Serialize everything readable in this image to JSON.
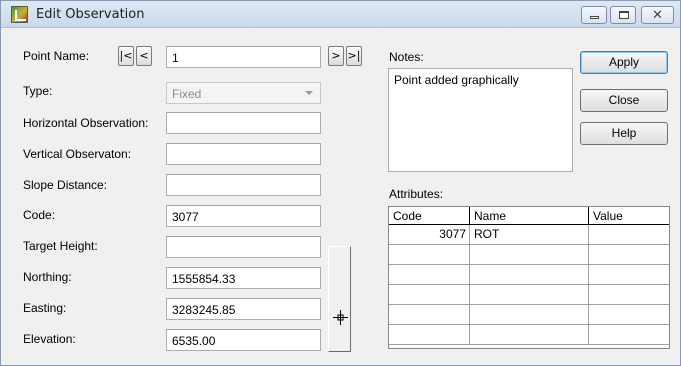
{
  "window": {
    "title": "Edit Observation",
    "controls": [
      "minimize",
      "maximize",
      "close"
    ]
  },
  "form": {
    "point_name_label": "Point Name:",
    "point_name_value": "1",
    "nav_first": "|<",
    "nav_prev": "<",
    "nav_next": ">",
    "nav_last": ">|",
    "type_label": "Type:",
    "type_value": "Fixed",
    "horizontal_label": "Horizontal Observation:",
    "horizontal_value": "",
    "vertical_label": "Vertical Observaton:",
    "vertical_value": "",
    "slope_label": "Slope Distance:",
    "slope_value": "",
    "code_label": "Code:",
    "code_value": "3077",
    "target_label": "Target Height:",
    "target_value": "",
    "northing_label": "Northing:",
    "northing_value": "1555854.33",
    "easting_label": "Easting:",
    "easting_value": "3283245.85",
    "elevation_label": "Elevation:",
    "elevation_value": "6535.00"
  },
  "notes": {
    "label": "Notes:",
    "text": "Point added graphically"
  },
  "attributes": {
    "label": "Attributes:",
    "columns": [
      "Code",
      "Name",
      "Value"
    ],
    "rows": [
      [
        "3077",
        "ROT",
        ""
      ],
      [
        "",
        "",
        ""
      ],
      [
        "",
        "",
        ""
      ],
      [
        "",
        "",
        ""
      ],
      [
        "",
        "",
        ""
      ],
      [
        "",
        "",
        ""
      ]
    ]
  },
  "buttons": {
    "apply": "Apply",
    "close": "Close",
    "help": "Help"
  },
  "icons": {
    "app": "edit-observation-app-icon",
    "pick": "crosshair-icon"
  }
}
